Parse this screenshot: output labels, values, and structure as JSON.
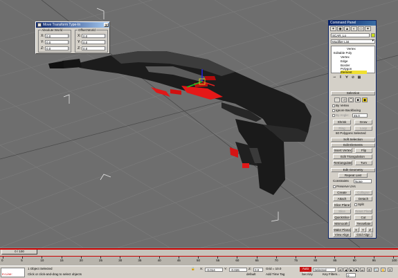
{
  "viewport": {
    "name": "Perspective viewport"
  },
  "move_dialog": {
    "title": "Move Transform Type-In",
    "close": "x",
    "absolute": {
      "legend": "Absolute:World",
      "x_label": "X:",
      "x": "0.0",
      "y_label": "Y:",
      "y": "0.0",
      "z_label": "Z:",
      "z": "0.0"
    },
    "offset": {
      "legend": "Offset:World",
      "x_label": "X:",
      "x": "0.0",
      "y_label": "Y:",
      "y": "0.0",
      "z_label": "Z:",
      "z": "0.0"
    }
  },
  "command_panel": {
    "title": "Command Panel",
    "tabs": [
      "✶",
      "◉",
      "▲",
      "◐",
      "▭",
      "✦"
    ],
    "object_name": "SCAR_Lo",
    "modifier_list": "Modifier List",
    "stack": {
      "vertex_top": "Vertex",
      "editable_poly": "Editable Poly",
      "vertex": "Vertex",
      "edge": "Edge",
      "border": "Border",
      "polygon": "Polygon",
      "element": "Element"
    },
    "stack_tools": [
      "⊸",
      "‖",
      "∀",
      "⊘",
      "▦"
    ],
    "selection": {
      "header": "Selection",
      "icons": [
        "·",
        "◁",
        "◯",
        "■",
        "◆"
      ],
      "by_vertex": "By Vertex",
      "ignore_backfacing": "Ignore Backfacing",
      "by_angle": "By Angle:",
      "angle_value": "45.0",
      "shrink": "Shrink",
      "grow": "Grow",
      "ring": "Ring",
      "loop": "Loop",
      "status": "60 Polygons Selected"
    },
    "soft_selection": {
      "header": "Soft Selection"
    },
    "edit_elements": {
      "header": "Edit Elements",
      "insert_vertex": "Insert Vertex",
      "flip": "Flip",
      "edit_triangulation": "Edit Triangulation",
      "retriangulate": "Retriangulate",
      "turn": "Turn"
    },
    "edit_geometry": {
      "header": "Edit Geometry",
      "repeat_last": "Repeat Last",
      "constraints_label": "Constraints",
      "constraints_value": "None",
      "preserve_uvs": "Preserve UVs",
      "create": "Create",
      "collapse": "Collapse",
      "attach": "Attach",
      "detach": "Detach",
      "slice_plane": "Slice Plane",
      "split": "Split",
      "slice": "Slice",
      "reset_plane": "Reset Plane",
      "quickslice": "QuickSlice",
      "cut": "Cut",
      "msmooth": "MSmooth",
      "tessellate": "Tessellate",
      "make_planar": "Make Planar",
      "x": "X",
      "y": "Y",
      "z": "Z",
      "view_align": "View Align",
      "grid_align": "Grid Align"
    }
  },
  "timeline": {
    "slider_label": "0 / 100",
    "ticks": [
      "0",
      "5",
      "10",
      "15",
      "20",
      "25",
      "30",
      "35",
      "40",
      "45",
      "50",
      "55",
      "60",
      "65",
      "70",
      "75",
      "80",
      "85",
      "90",
      "95",
      "100"
    ]
  },
  "status_bar": {
    "maxscript": "In Line:",
    "object_status": "1 Object Selected",
    "prompt": "Click or click-and-drag to select objects",
    "x_label": "X:",
    "x_value": "-0.014",
    "y_label": "Y:",
    "y_value": "-0.026",
    "z_label": "Z:",
    "z_value": "0.0",
    "grid": "Grid = 10.0",
    "add_time_tag": "Add Time Tag",
    "auto_key": "Auto Key",
    "set_key": "Set Key",
    "key_mode": "Selected",
    "key_filters": "Key Filters...",
    "frame": "0",
    "default": "default"
  },
  "colors": {
    "accent_red": "#c81414",
    "selection_yellow": "#f0e030",
    "title_blue": "#0a246a"
  }
}
